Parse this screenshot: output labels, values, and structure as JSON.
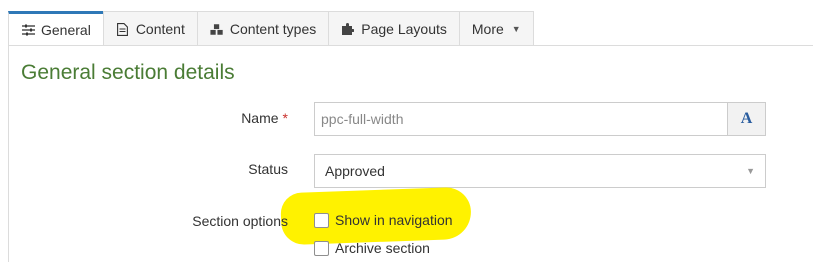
{
  "tabs": [
    {
      "label": "General",
      "icon": "sliders-icon",
      "active": true
    },
    {
      "label": "Content",
      "icon": "document-icon"
    },
    {
      "label": "Content types",
      "icon": "cubes-icon"
    },
    {
      "label": "Page Layouts",
      "icon": "puzzle-icon"
    },
    {
      "label": "More",
      "icon": "caret-down-icon"
    }
  ],
  "section_title": "General section details",
  "name_field": {
    "label": "Name",
    "required_marker": "*",
    "value": "ppc-full-width",
    "addon": "A"
  },
  "status_field": {
    "label": "Status",
    "value": "Approved"
  },
  "section_options": {
    "label": "Section options",
    "options": [
      "Show in navigation",
      "Archive section"
    ]
  },
  "colors": {
    "accent": "#2e78b7",
    "title": "#4a7c35",
    "highlight": "#fff200",
    "required": "#c9302c"
  }
}
